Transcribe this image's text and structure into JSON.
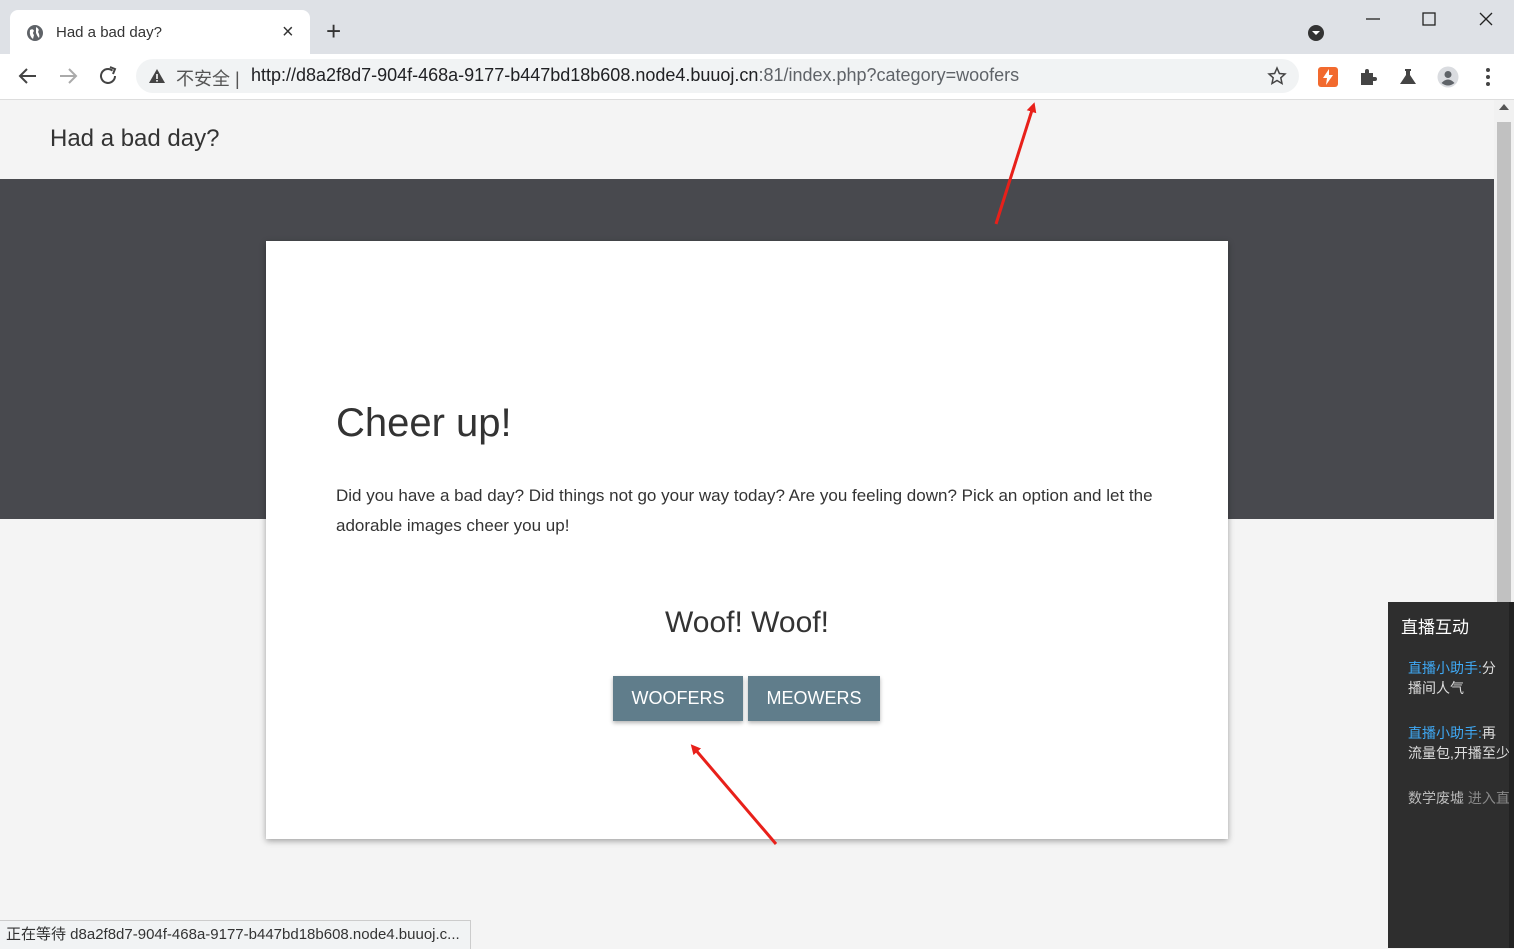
{
  "browser": {
    "tab_title": "Had a bad day?",
    "tab_close": "×",
    "new_tab": "+",
    "security_label": "不安全",
    "url_host": "http://d8a2f8d7-904f-468a-9177-b447bd18b608.node4.buuoj.cn",
    "url_rest": ":81/index.php?category=woofers",
    "status_text": "正在等待 d8a2f8d7-904f-468a-9177-b447bd18b608.node4.buuoj.c..."
  },
  "page": {
    "site_title": "Had a bad day?",
    "heading": "Cheer up!",
    "description": "Did you have a bad day? Did things not go your way today? Are you feeling down? Pick an option and let the adorable images cheer you up!",
    "result_text": "Woof! Woof!",
    "buttons": [
      {
        "label": "WOOFERS"
      },
      {
        "label": "MEOWERS"
      }
    ],
    "button_color": "#607d8b",
    "hero_color": "#48494e"
  },
  "live_panel": {
    "title": "直播互动",
    "messages": [
      {
        "user": "直播小助手:",
        "text1": "分",
        "text2": "播间人气"
      },
      {
        "user": "直播小助手:",
        "text1": "再",
        "text2": "流量包,开播至少"
      },
      {
        "user": "数学废墟",
        "text1": "进入直"
      }
    ]
  },
  "annotation_color": "#e8201a"
}
